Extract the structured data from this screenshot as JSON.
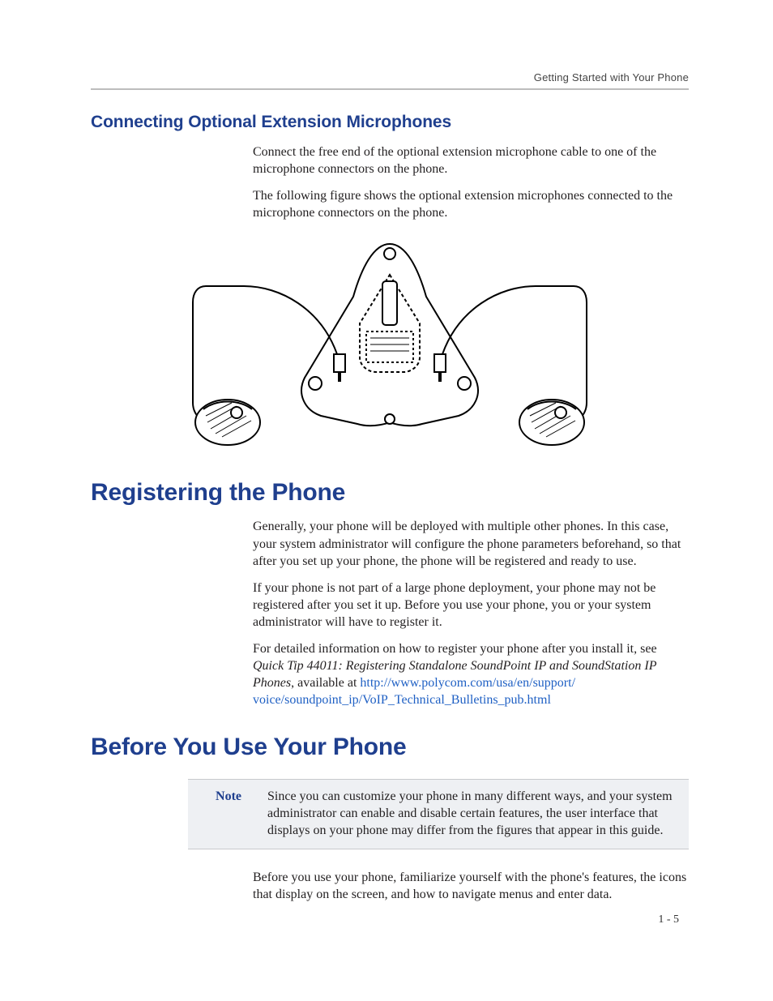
{
  "running_head": "Getting Started with Your Phone",
  "section_connect": {
    "heading": "Connecting Optional Extension Microphones",
    "p1": "Connect the free end of the optional extension microphone cable to one of the microphone connectors on the phone.",
    "p2": "The following figure shows the optional extension microphones connected to the microphone connectors on the phone."
  },
  "section_register": {
    "heading": "Registering the Phone",
    "p1": "Generally, your phone will be deployed with multiple other phones. In this case, your system administrator will configure the phone parameters beforehand, so that after you set up your phone, the phone will be registered and ready to use.",
    "p2": "If your phone is not part of a large phone deployment, your phone may not be registered after you set it up. Before you use your phone, you or your system administrator will have to register it.",
    "p3_intro": "For detailed information on how to register your phone after you install it, see ",
    "p3_doc_title": "Quick Tip 44011: Registering Standalone SoundPoint IP and SoundStation IP Phones",
    "p3_after": ", available at ",
    "link1": "http://www.polycom.com/usa/en/support/",
    "link2": "voice/soundpoint_ip/VoIP_Technical_Bulletins_pub.html"
  },
  "section_before": {
    "heading": "Before You Use Your Phone",
    "note_label": "Note",
    "note_text": "Since you can customize your phone in many different ways, and your system administrator can enable and disable certain features, the user interface that displays on your phone may differ from the figures that appear in this guide.",
    "p1": "Before you use your phone, familiarize yourself with the phone's features, the icons that display on the screen, and how to navigate menus and enter data."
  },
  "page_number": "1 - 5"
}
